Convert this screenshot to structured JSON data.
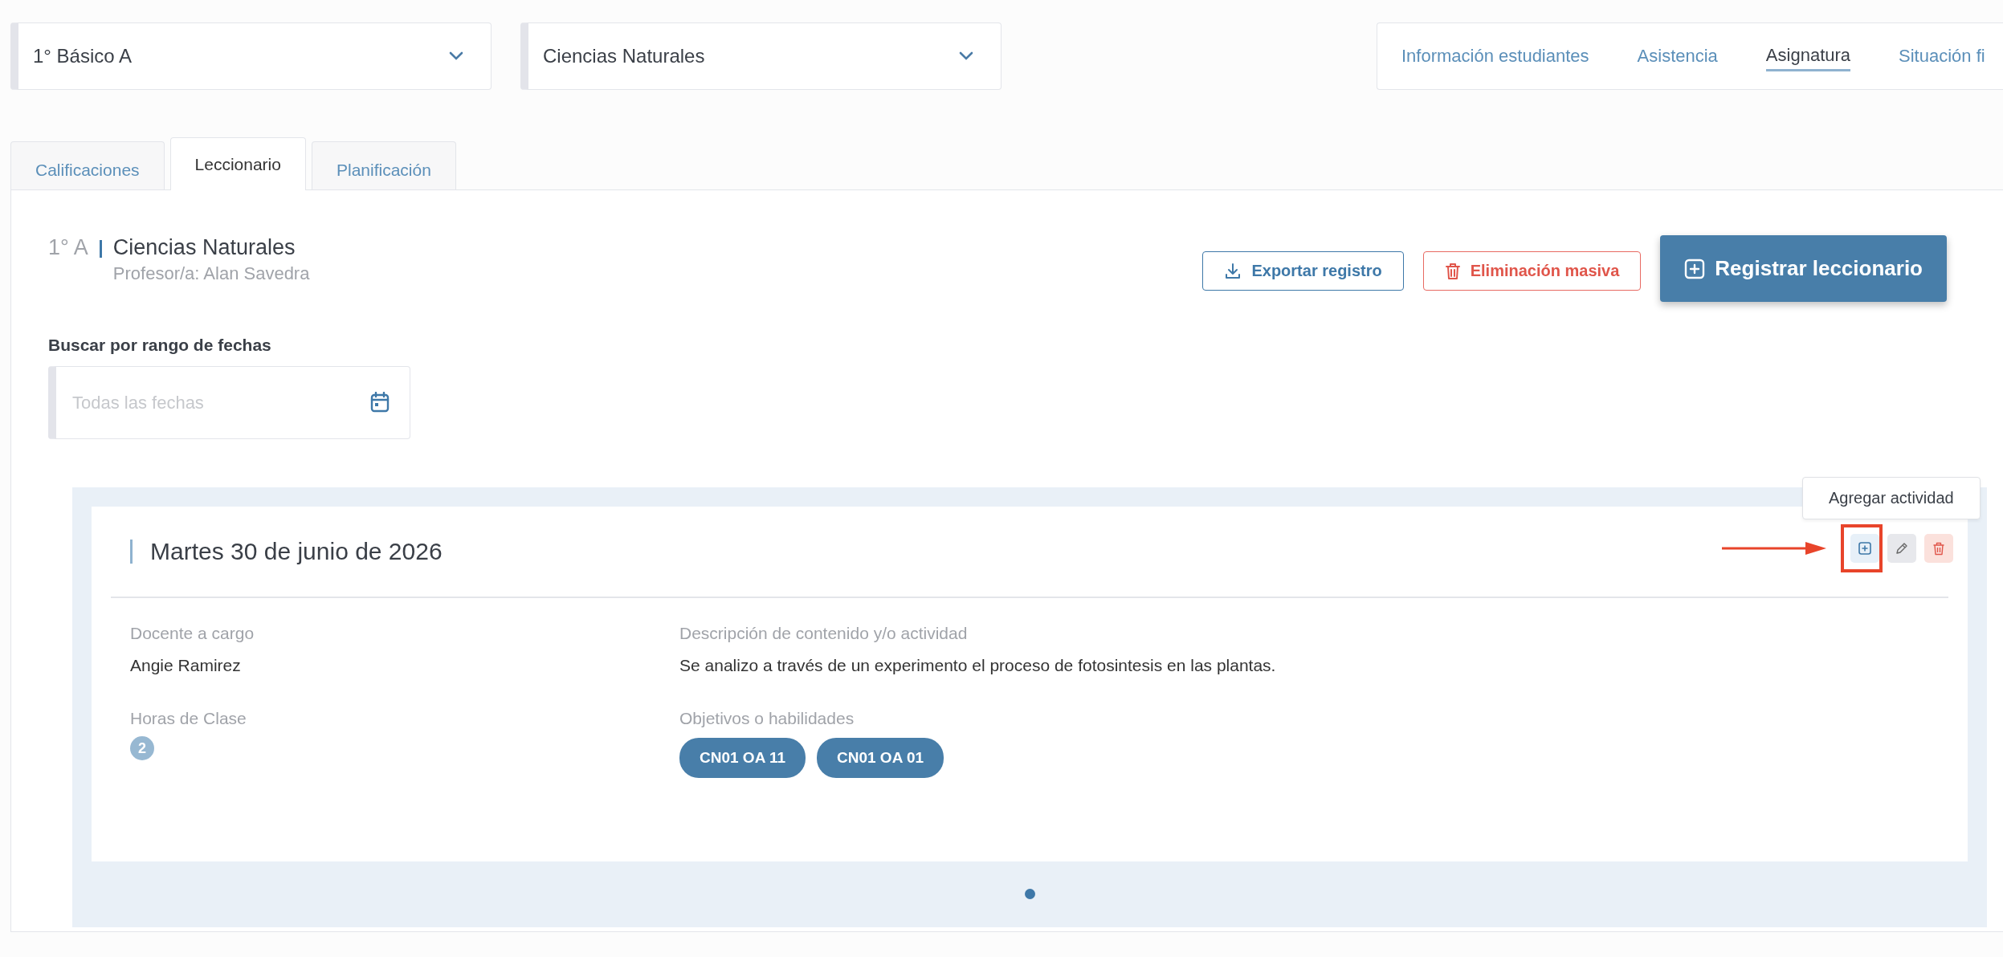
{
  "selectors": [
    {
      "value": "1° Básico A"
    },
    {
      "value": "Ciencias Naturales"
    }
  ],
  "nav_tabs": [
    {
      "label": "Información estudiantes",
      "selected": false
    },
    {
      "label": "Asistencia",
      "selected": false
    },
    {
      "label": "Asignatura",
      "selected": true
    },
    {
      "label": "Situación fi",
      "selected": false
    }
  ],
  "tabs": [
    {
      "label": "Calificaciones",
      "selected": false
    },
    {
      "label": "Leccionario",
      "selected": true
    },
    {
      "label": "Planificación",
      "selected": false
    }
  ],
  "header": {
    "course": "1° A",
    "subject": "Ciencias Naturales",
    "teacher": "Profesor/a: Alan Savedra"
  },
  "buttons": [
    {
      "kind": "outline",
      "label": "Exportar registro"
    },
    {
      "kind": "danger",
      "label": "Eliminación masiva"
    },
    {
      "kind": "primary",
      "label": "Registrar leccionario"
    }
  ],
  "date_filter": {
    "label": "Buscar por rango de fechas",
    "placeholder": "Todas las fechas"
  },
  "card": {
    "date": "Martes 30 de junio de 2026",
    "tooltip": "Agregar actividad",
    "teacher_label": "Docente a cargo",
    "teacher": "Angie Ramirez",
    "hours_label": "Horas de Clase",
    "hours": "2",
    "description_label": "Descripción de contenido y/o actividad",
    "description": "Se analizo a través de un experimento el proceso de fotosintesis en las plantas.",
    "objectives_label": "Objetivos o habilidades",
    "objectives": [
      "CN01 OA 11",
      "CN01 OA 01"
    ]
  },
  "pagination": [
    {
      "selected": true
    }
  ]
}
